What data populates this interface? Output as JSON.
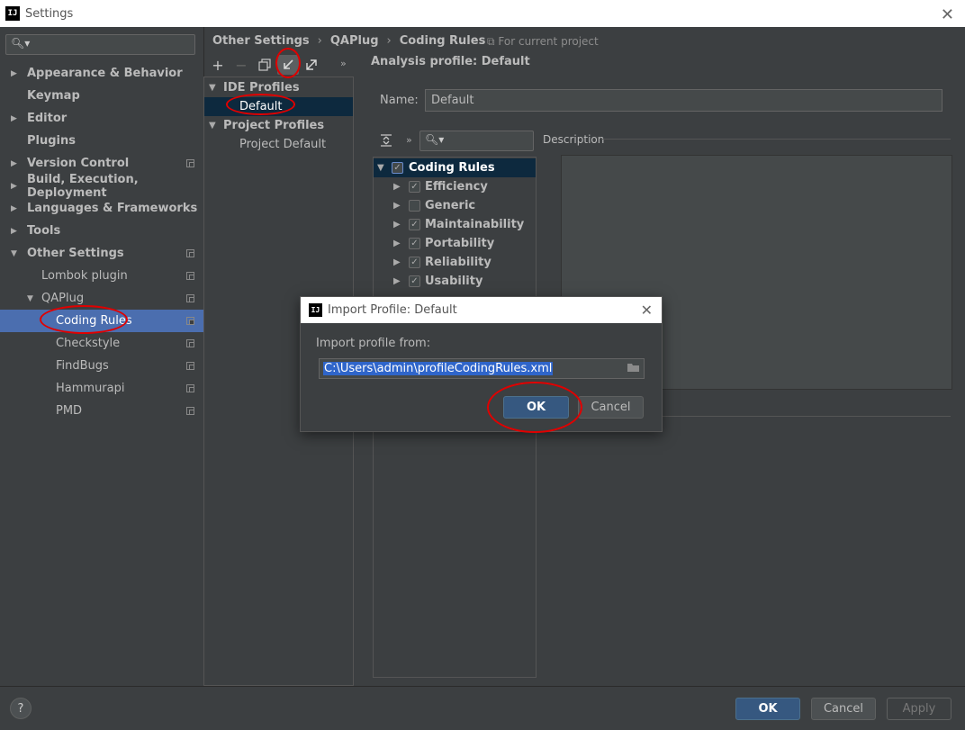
{
  "window": {
    "title": "Settings",
    "app_icon": "IJ"
  },
  "sidebar": {
    "items": [
      {
        "label": "Appearance & Behavior",
        "expand": "collapsed",
        "bold": true
      },
      {
        "label": "Keymap",
        "expand": "none",
        "bold": true
      },
      {
        "label": "Editor",
        "expand": "collapsed",
        "bold": true
      },
      {
        "label": "Plugins",
        "expand": "none",
        "bold": true
      },
      {
        "label": "Version Control",
        "expand": "collapsed",
        "bold": true,
        "copy": true
      },
      {
        "label": "Build, Execution, Deployment",
        "expand": "collapsed",
        "bold": true
      },
      {
        "label": "Languages & Frameworks",
        "expand": "collapsed",
        "bold": true
      },
      {
        "label": "Tools",
        "expand": "collapsed",
        "bold": true
      },
      {
        "label": "Other Settings",
        "expand": "expanded",
        "bold": true,
        "copy": true
      },
      {
        "label": "Lombok plugin",
        "copy": true
      },
      {
        "label": "QAPlug",
        "expand": "expanded",
        "copy": true
      },
      {
        "label": "Coding Rules",
        "copy": true,
        "selected": true
      },
      {
        "label": "Checkstyle",
        "copy": true
      },
      {
        "label": "FindBugs",
        "copy": true
      },
      {
        "label": "Hammurapi",
        "copy": true
      },
      {
        "label": "PMD",
        "copy": true
      }
    ]
  },
  "breadcrumb": {
    "parts": [
      "Other Settings",
      "QAPlug",
      "Coding Rules"
    ],
    "scope": "For current project"
  },
  "toolbar": {
    "add": "+",
    "remove": "−",
    "more": "»"
  },
  "profiles": {
    "ide_header": "IDE Profiles",
    "ide_default": "Default",
    "project_header": "Project Profiles",
    "project_default": "Project Default"
  },
  "analysis": {
    "title": "Analysis profile: Default",
    "name_label": "Name:",
    "name_value": "Default",
    "description_label": "Description",
    "more": "»"
  },
  "rules": {
    "root": {
      "label": "Coding Rules",
      "checked": true
    },
    "children": [
      {
        "label": "Efficiency",
        "checked": true
      },
      {
        "label": "Generic",
        "checked": false
      },
      {
        "label": "Maintainability",
        "checked": true
      },
      {
        "label": "Portability",
        "checked": true
      },
      {
        "label": "Reliability",
        "checked": true
      },
      {
        "label": "Usability",
        "checked": true
      }
    ]
  },
  "dialog": {
    "title": "Import Profile: Default",
    "label": "Import profile from:",
    "path": "C:\\Users\\admin\\profileCodingRules.xml",
    "ok": "OK",
    "cancel": "Cancel"
  },
  "bottom": {
    "help": "?",
    "ok": "OK",
    "cancel": "Cancel",
    "apply": "Apply"
  },
  "colors": {
    "accent": "#4b6eaf",
    "annotation": "#e00000",
    "primary_button": "#365880"
  }
}
